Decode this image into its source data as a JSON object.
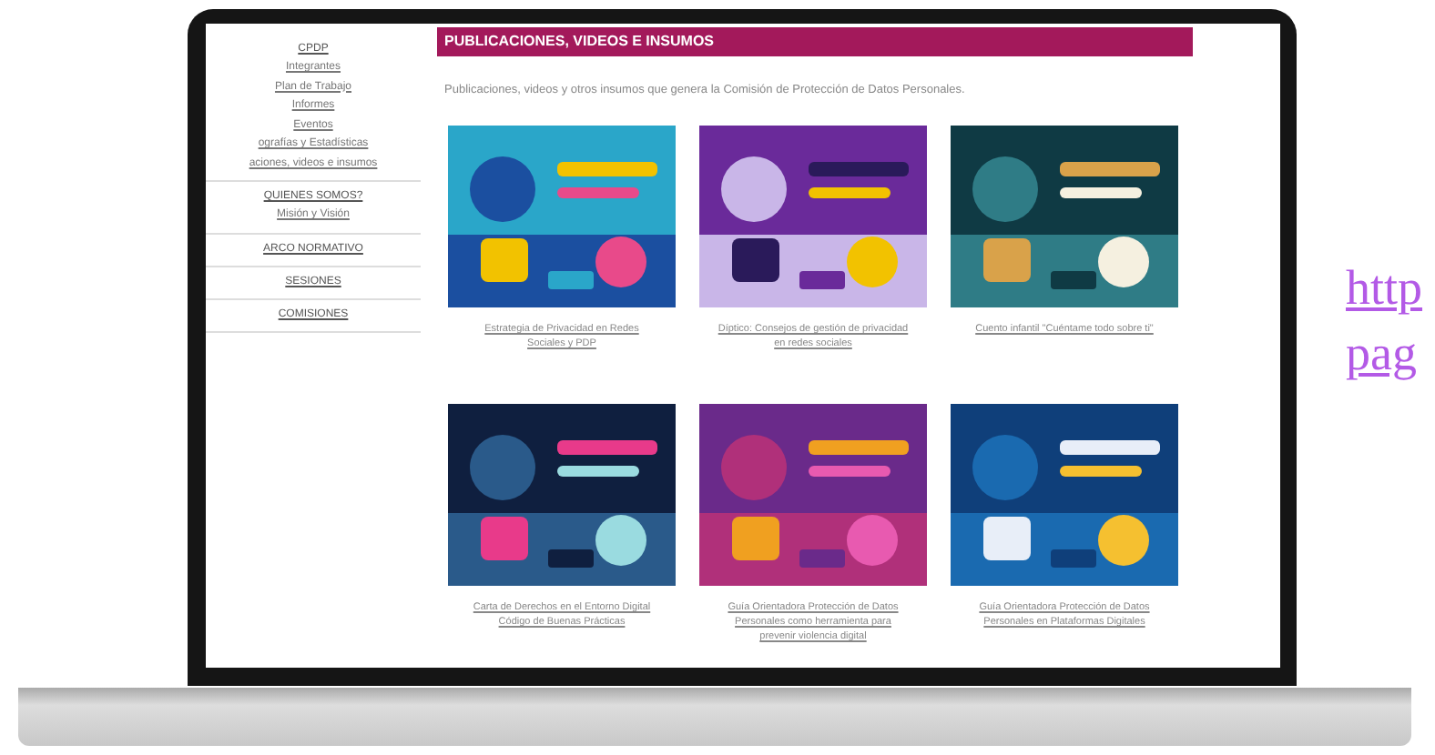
{
  "sidebar": [
    {
      "label": "CPDP",
      "children": [
        {
          "label": "Integrantes"
        },
        {
          "label": "Plan de Trabajo"
        },
        {
          "label": "Informes"
        },
        {
          "label": "Eventos"
        },
        {
          "label": "ografías y Estadísticas"
        },
        {
          "label": "aciones, videos e insumos"
        }
      ]
    },
    {
      "label": "QUIENES SOMOS?",
      "children": [
        {
          "label": "Misión y Visión"
        }
      ]
    },
    {
      "label": "ARCO NORMATIVO"
    },
    {
      "label": "SESIONES"
    },
    {
      "label": "COMISIONES"
    }
  ],
  "page": {
    "title": "PUBLICACIONES, VIDEOS E INSUMOS",
    "description": "Publicaciones, videos y otros insumos que genera la Comisión de Protección de Datos Personales."
  },
  "publications": [
    {
      "caption": "Estrategia de Privacidad en Redes Sociales y PDP"
    },
    {
      "caption": "Díptico: Consejos de gestión de privacidad en redes sociales"
    },
    {
      "caption": "Cuento infantil \"Cuéntame todo sobre ti\""
    },
    {
      "caption": "Carta de Derechos en el Entorno Digital Código de Buenas Prácticas"
    },
    {
      "caption": "Guía Orientadora Protección de Datos Personales como herramienta para prevenir violencia digital"
    },
    {
      "caption": "Guía Orientadora Protección de Datos Personales en Plataformas Digitales"
    }
  ],
  "side_link": [
    "http",
    "pag"
  ]
}
